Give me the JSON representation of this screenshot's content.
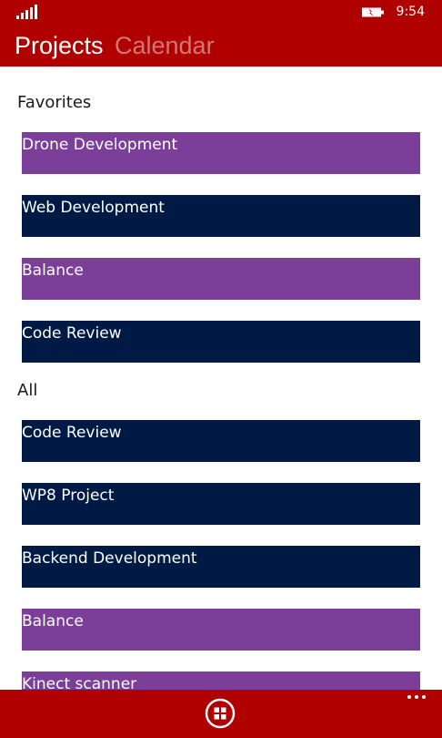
{
  "status_bar": {
    "time": "9:54",
    "signal_icon": "signal-strength-icon",
    "battery_icon": "battery-charging-icon"
  },
  "pivot": {
    "tabs": [
      {
        "label": "Projects",
        "active": true
      },
      {
        "label": "Calendar",
        "active": false
      }
    ]
  },
  "groups": {
    "favorites": {
      "header": "Favorites",
      "items": [
        {
          "label": "Drone Development",
          "color": "#7b3f99"
        },
        {
          "label": "Web Development",
          "color": "#001a46"
        },
        {
          "label": "Balance",
          "color": "#7b3f99"
        },
        {
          "label": "Code Review",
          "color": "#001a46"
        }
      ]
    },
    "all": {
      "header": "All",
      "items": [
        {
          "label": "Code Review",
          "color": "#001a46"
        },
        {
          "label": "WP8 Project",
          "color": "#001a46"
        },
        {
          "label": "Backend Development",
          "color": "#001a46"
        },
        {
          "label": "Balance",
          "color": "#7b3f99"
        },
        {
          "label": "Kinect scanner",
          "color": "#7b3f99"
        }
      ]
    }
  },
  "app_bar": {
    "primary_icon": "grid-icon",
    "more_icon": "more-ellipsis-icon"
  },
  "colors": {
    "brand": "#b00000",
    "purple": "#7b3f99",
    "navy": "#001a46",
    "inactive_tab": "#d37676"
  }
}
